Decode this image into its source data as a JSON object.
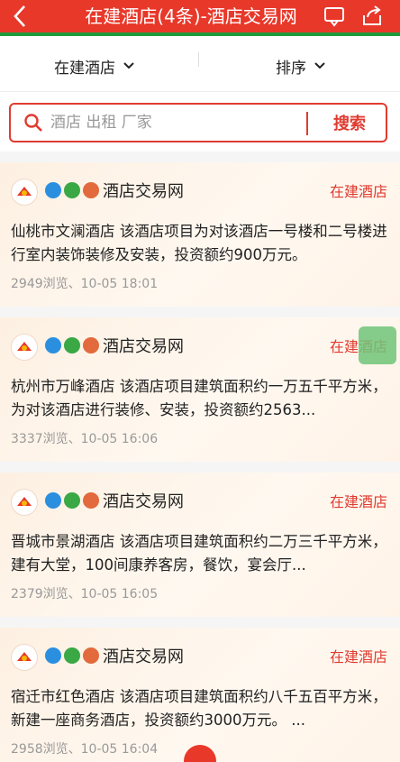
{
  "header": {
    "title": "在建酒店(4条)-酒店交易网"
  },
  "filters": {
    "category": "在建酒店",
    "sort": "排序"
  },
  "search": {
    "placeholder": "酒店 出租 厂家",
    "button": "搜索"
  },
  "listings": [
    {
      "source": "酒店交易网",
      "category": "在建酒店",
      "description": "仙桃市文澜酒店 该酒店项目为对该酒店一号楼和二号楼进行室内装饰装修及安装，投资额约900万元。",
      "meta": "2949浏览、10-05 18:01"
    },
    {
      "source": "酒店交易网",
      "category": "在建酒店",
      "description": "杭州市万峰酒店 该酒店项目建筑面积约一万五千平方米，为对该酒店进行装修、安装，投资额约2563...",
      "meta": "3337浏览、10-05 16:06"
    },
    {
      "source": "酒店交易网",
      "category": "在建酒店",
      "description": "晋城市景湖酒店 该酒店项目建筑面积约二万三千平方米，建有大堂，100间康养客房，餐饮，宴会厅...",
      "meta": "2379浏览、10-05 16:05"
    },
    {
      "source": "酒店交易网",
      "category": "在建酒店",
      "description": "宿迁市红色酒店 该酒店项目建筑面积约八千五百平方米，新建一座商务酒店，投资额约3000万元。 ...",
      "meta": "2958浏览、10-05 16:04"
    }
  ],
  "colors": {
    "brand_red": "#e8382a",
    "accent_green": "#1e9a3c"
  }
}
